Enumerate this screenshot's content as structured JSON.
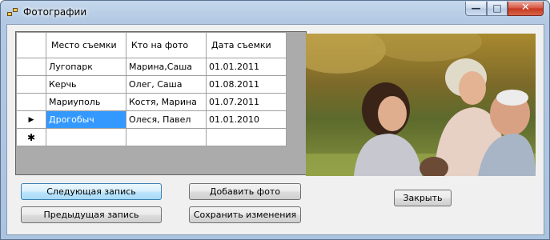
{
  "window": {
    "title": "Фотографии",
    "minimize_glyph": "—",
    "maximize_glyph": "□",
    "close_glyph": "✕"
  },
  "grid": {
    "columns": [
      "Место съемки",
      "Кто на фото",
      "Дата съемки"
    ],
    "rows": [
      {
        "place": "Лугопарк",
        "who": "Марина,Саша",
        "date": "01.01.2011",
        "indicator": ""
      },
      {
        "place": "Керчь",
        "who": "Олег, Саша",
        "date": "01.08.2011",
        "indicator": ""
      },
      {
        "place": "Мариуполь",
        "who": "Костя, Марина",
        "date": "01.07.2011",
        "indicator": ""
      },
      {
        "place": "Дрогобыч",
        "who": "Олеся, Павел",
        "date": "01.01.2010",
        "indicator": "▶"
      }
    ],
    "new_row_indicator": "✱"
  },
  "buttons": {
    "next": "Следующая запись",
    "prev": "Предыдущая запись",
    "add_photo": "Добавить фото",
    "save": "Сохранить изменения",
    "close": "Закрыть"
  },
  "colors": {
    "selection": "#3399ff",
    "grid_bg": "#ababab"
  }
}
